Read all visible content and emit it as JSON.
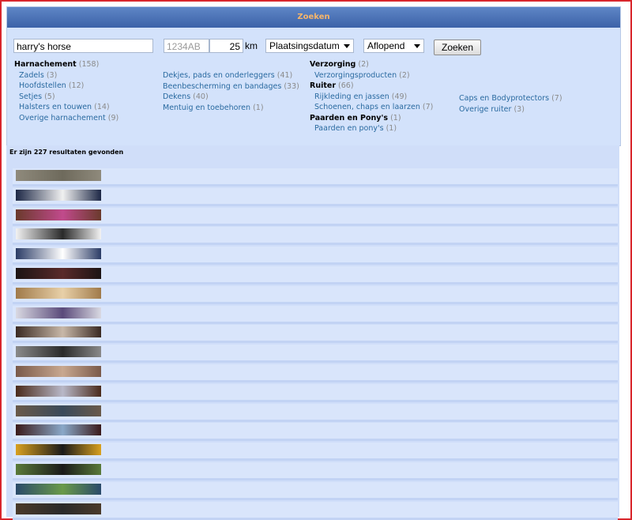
{
  "header": {
    "title": "Zoeken"
  },
  "search": {
    "query": "harry's horse",
    "postcode_placeholder": "1234AB",
    "distance_value": "25",
    "distance_unit": "km",
    "sort_field": "Plaatsingsdatum",
    "sort_order": "Aflopend",
    "submit_label": "Zoeken"
  },
  "categories": {
    "col1": {
      "heading": "Harnachement",
      "heading_count": "(158)",
      "items": [
        {
          "label": "Zadels",
          "count": "(3)"
        },
        {
          "label": "Hoofdstellen",
          "count": "(12)"
        },
        {
          "label": "Setjes",
          "count": "(5)"
        },
        {
          "label": "Halsters en touwen",
          "count": "(14)"
        },
        {
          "label": "Overige harnachement",
          "count": "(9)"
        }
      ]
    },
    "col2": {
      "items": [
        {
          "label": "Dekjes, pads en onderleggers",
          "count": "(41)"
        },
        {
          "label": "Beenbescherming en bandages",
          "count": "(33)"
        },
        {
          "label": "Dekens",
          "count": "(40)"
        },
        {
          "label": "Mentuig en toebehoren",
          "count": "(1)"
        }
      ]
    },
    "verzorging": {
      "heading": "Verzorging",
      "heading_count": "(2)",
      "items": [
        {
          "label": "Verzorgingsproducten",
          "count": "(2)"
        }
      ]
    },
    "ruiter": {
      "heading": "Ruiter",
      "heading_count": "(66)",
      "items": [
        {
          "label": "Rijkleding en jassen",
          "count": "(49)"
        },
        {
          "label": "Schoenen, chaps en laarzen",
          "count": "(7)"
        }
      ],
      "items2": [
        {
          "label": "Caps en Bodyprotectors",
          "count": "(7)"
        },
        {
          "label": "Overige ruiter",
          "count": "(3)"
        }
      ]
    },
    "paarden": {
      "heading": "Paarden en Pony's",
      "heading_count": "(1)",
      "items": [
        {
          "label": "Paarden en pony's",
          "count": "(1)"
        }
      ]
    }
  },
  "results": {
    "count_text": "Er zijn 227 resultaten gevonden",
    "thumb_colors": [
      [
        "#8f8a7c",
        "#6e6a5c"
      ],
      [
        "#1d2846",
        "#f0f0f0"
      ],
      [
        "#6a3a2c",
        "#c14a8c"
      ],
      [
        "#f2f2f2",
        "#2a2a2a"
      ],
      [
        "#2b3c66",
        "#ffffff"
      ],
      [
        "#1c1414",
        "#5a2a2a"
      ],
      [
        "#a07a4a",
        "#e8d0a8"
      ],
      [
        "#d9d9e2",
        "#5a4a7a"
      ],
      [
        "#3a2a22",
        "#c8b8a8"
      ],
      [
        "#8a8a8a",
        "#2a2a2a"
      ],
      [
        "#7a5a4a",
        "#c8a890"
      ],
      [
        "#4a2a1a",
        "#b8b8c8"
      ],
      [
        "#6a5a4a",
        "#3a4a5a"
      ],
      [
        "#3a1a1a",
        "#8aa8c8"
      ],
      [
        "#d8a020",
        "#1a1a1a"
      ],
      [
        "#5a7a3a",
        "#1a1a1a"
      ],
      [
        "#2a4a6a",
        "#6a9a4a"
      ],
      [
        "#4a3a2a",
        "#2a2a2a"
      ]
    ]
  }
}
